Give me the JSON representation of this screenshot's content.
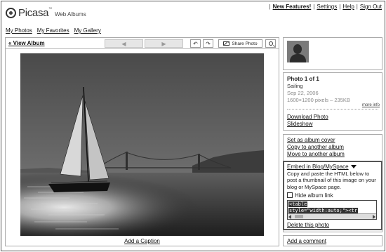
{
  "header": {
    "logo_text": "Picasa",
    "logo_tm": "™",
    "logo_sub": "Web Albums",
    "links": [
      "New Features!",
      "Settings",
      "Help",
      "Sign Out"
    ],
    "separator": "|"
  },
  "tabs": [
    "My Photos",
    "My Favorites",
    "My Gallery"
  ],
  "toolbar": {
    "view_album": "« View Album",
    "prev_glyph": "◀",
    "next_glyph": "▶",
    "rotate_left_glyph": "↶",
    "rotate_right_glyph": "↷",
    "share_label": "Share Photo"
  },
  "photo": {
    "caption_link": "Add a Caption"
  },
  "info": {
    "title": "Photo 1 of 1",
    "name": "Sailing",
    "date": "Sep 22, 2006",
    "dimensions": "1600×1200 pixels – 235KB",
    "more_info": "more info",
    "download": "Download Photo",
    "slideshow": "Slideshow"
  },
  "actions": {
    "set_cover": "Set as album cover",
    "copy": "Copy to another album",
    "move": "Move to another album"
  },
  "embed": {
    "heading": "Embed in Blog/MySpace",
    "description": "Copy and paste the HTML below to post a thumbnail of this image on your blog or MySpace page.",
    "hide_album_link": "Hide album link",
    "code_line1": "<table",
    "code_line2": "style=\"width:auto;\"><tr"
  },
  "delete": "Delete this photo",
  "add_comment": "Add a comment",
  "colors": {
    "border": "#aaaaaa",
    "embed_border": "#555555",
    "link": "#111111"
  }
}
